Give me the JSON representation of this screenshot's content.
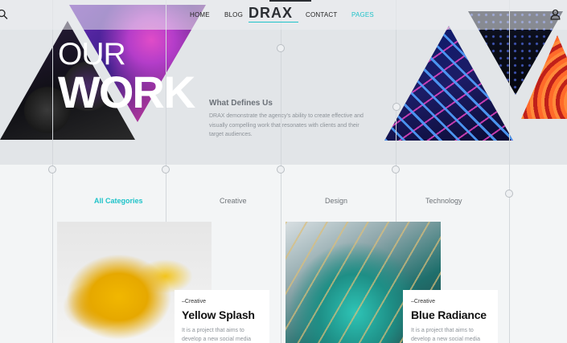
{
  "nav": {
    "items": [
      "HOME",
      "BLOG",
      "CONTACT",
      "PAGES"
    ],
    "logo": "DRAX",
    "active": "PAGES"
  },
  "hero": {
    "title_line1": "OUR",
    "title_line2": "WORK",
    "section_title": "What Defines Us",
    "description": "DRAX demonstrate the agency's ability to create effective and visually compelling work that resonates with clients and their target audiences."
  },
  "filters": {
    "items": [
      "All Categories",
      "Creative",
      "Design",
      "Technology"
    ],
    "active": "All Categories"
  },
  "projects": [
    {
      "category": "–Creative",
      "title": "Yellow Splash",
      "description": "It is a project that aims to develop a new social media"
    },
    {
      "category": "–Creative",
      "title": "Blue Radiance",
      "description": "It is a project that aims to develop a new social media"
    }
  ],
  "icons": {
    "search": "search-icon",
    "user": "user-icon"
  },
  "colors": {
    "accent": "#1fc3c9",
    "text": "#1a1a1a",
    "muted": "#8d9399"
  }
}
